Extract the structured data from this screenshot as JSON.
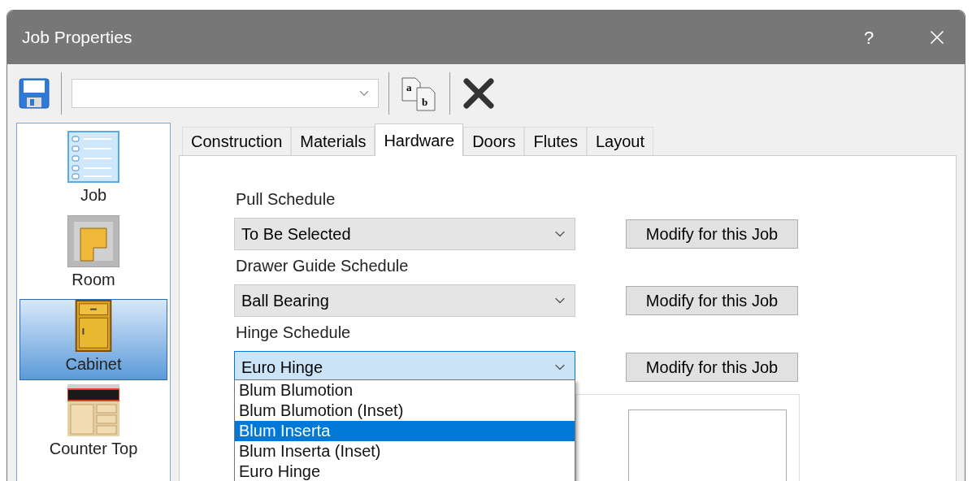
{
  "window": {
    "title": "Job Properties",
    "help": "?"
  },
  "toolbar": {
    "rename_icon": {
      "letters": [
        "a",
        "b"
      ]
    }
  },
  "sidebar": {
    "items": [
      {
        "kind": "job",
        "label": "Job",
        "selected": false
      },
      {
        "kind": "room",
        "label": "Room",
        "selected": false
      },
      {
        "kind": "cabinet",
        "label": "Cabinet",
        "selected": true
      },
      {
        "kind": "countertop",
        "label": "Counter Top",
        "selected": false
      }
    ]
  },
  "tabs": [
    {
      "label": "Construction",
      "selected": false
    },
    {
      "label": "Materials",
      "selected": false
    },
    {
      "label": "Hardware",
      "selected": true
    },
    {
      "label": "Doors",
      "selected": false
    },
    {
      "label": "Flutes",
      "selected": false
    },
    {
      "label": "Layout",
      "selected": false
    }
  ],
  "schedules": [
    {
      "label": "Pull Schedule",
      "value": "To Be Selected",
      "focused": false,
      "button": "Modify for this Job"
    },
    {
      "label": "Drawer Guide Schedule",
      "value": "Ball Bearing",
      "focused": false,
      "button": "Modify for this Job"
    },
    {
      "label": "Hinge Schedule",
      "value": "Euro Hinge",
      "focused": true,
      "open": true,
      "button": "Modify for this Job",
      "options": [
        {
          "label": "Blum Blumotion",
          "highlighted": false
        },
        {
          "label": "Blum Blumotion (Inset)",
          "highlighted": false
        },
        {
          "label": "Blum Inserta",
          "highlighted": true
        },
        {
          "label": "Blum Inserta (Inset)",
          "highlighted": false
        },
        {
          "label": "Euro Hinge",
          "highlighted": false
        }
      ]
    }
  ]
}
